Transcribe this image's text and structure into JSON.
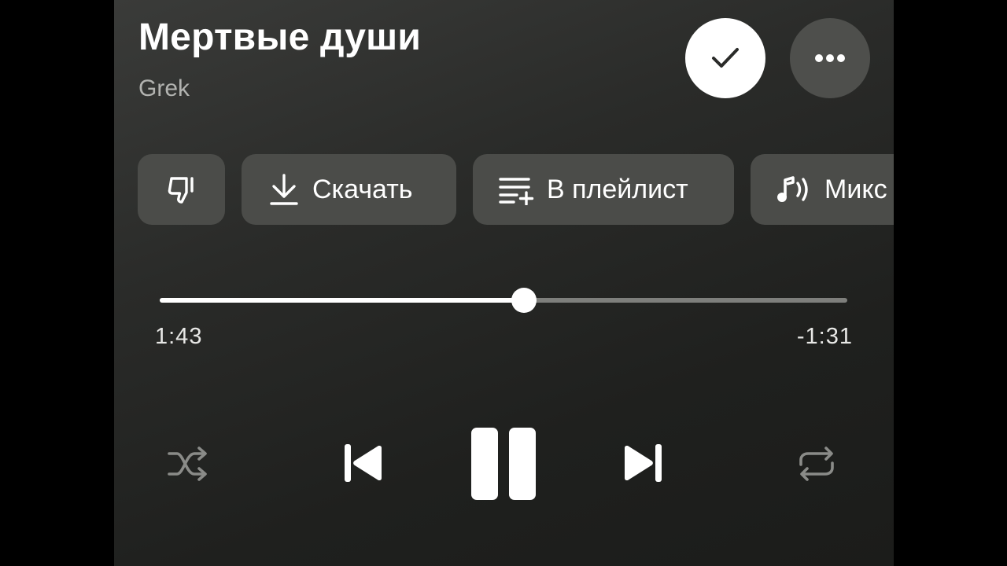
{
  "track": {
    "title": "Мертвые души",
    "artist": "Grek",
    "liked": true
  },
  "actions": [
    {
      "id": "dislike",
      "label": "",
      "icon": "thumbs-down-icon"
    },
    {
      "id": "download",
      "label": "Скачать",
      "icon": "download-icon"
    },
    {
      "id": "playlist",
      "label": "В плейлист",
      "icon": "add-to-playlist-icon"
    },
    {
      "id": "mix",
      "label": "Микс",
      "icon": "music-waves-icon"
    }
  ],
  "playback": {
    "elapsed": "1:43",
    "remaining": "-1:31",
    "progress": 0.53,
    "state": "playing"
  },
  "colors": {
    "accent": "#ffffff",
    "chip_bg": "#4b4c49",
    "track_bg": "#7e7f7c",
    "secondary_text": "#b2b3b0"
  }
}
